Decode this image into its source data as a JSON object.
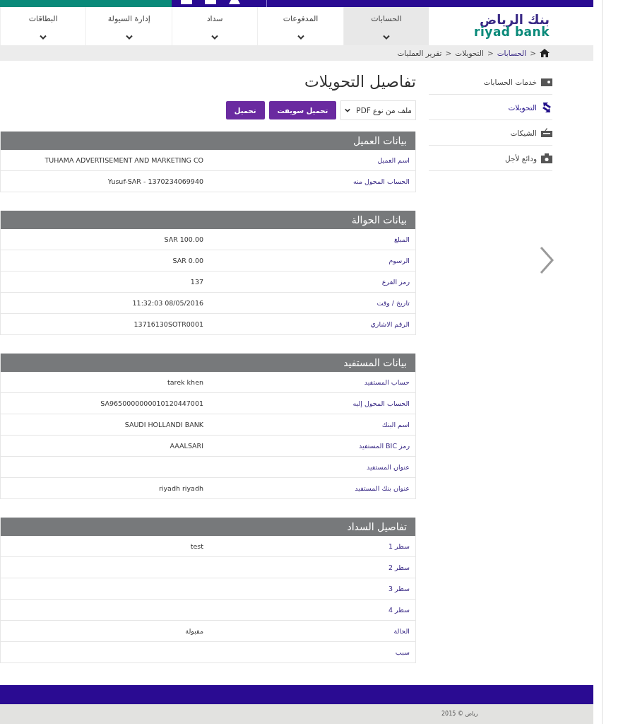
{
  "logo": {
    "arabic": "بنك الرياض",
    "latin": "riyad bank"
  },
  "nav": [
    {
      "label": "الحسابات",
      "selected": true
    },
    {
      "label": "المدفوعات",
      "selected": false
    },
    {
      "label": "سداد",
      "selected": false
    },
    {
      "label": "إدارة السيولة",
      "selected": false
    },
    {
      "label": "البطاقات",
      "selected": false
    }
  ],
  "breadcrumb": [
    {
      "separator": ">",
      "label": "الحسابات",
      "link": true
    },
    {
      "separator": ">",
      "label": "التحويلات",
      "link": false
    },
    {
      "separator": ">",
      "label": "تقرير العمليات",
      "link": false
    }
  ],
  "sidebar": {
    "items": [
      {
        "label": "خدمات الحسابات",
        "selected": false
      },
      {
        "label": "التحويلات",
        "selected": true
      },
      {
        "label": "الشيكات",
        "selected": false
      },
      {
        "label": "ودائع لأجل",
        "selected": false
      }
    ]
  },
  "page_title": "تفاصيل التحويلات",
  "file_type": {
    "value": "ملف من نوع PDF"
  },
  "buttons": [
    "تحميل سويفت",
    "تحميل"
  ],
  "sections": [
    {
      "title": "بيانات العميل",
      "rows": [
        {
          "label": "اسم العميل",
          "value": "TUHAMA ADVERTISEMENT AND MARKETING CO"
        },
        {
          "label": "الحساب المحول منه",
          "value": "Yusuf-SAR - 1370234069940"
        }
      ]
    },
    {
      "title": "بيانات الحوالة",
      "rows": [
        {
          "label": "المبلغ",
          "value": "SAR 100.00"
        },
        {
          "label": "الرسوم",
          "value": "SAR 0.00"
        },
        {
          "label": "رمز الفرع",
          "value": "137"
        },
        {
          "label": "تاريخ / وقت",
          "value": "11:32:03 08/05/2016"
        },
        {
          "label": "الرقم الاشاري",
          "value": "13716130SOTR0001"
        }
      ]
    },
    {
      "title": "بيانات المستفيد",
      "rows": [
        {
          "label": "حساب المستفيد",
          "value": "tarek khen"
        },
        {
          "label": "الحساب المحول إليه",
          "value": "SA9650000000010120447001"
        },
        {
          "label": "اسم البنك",
          "value": "SAUDI HOLLANDI BANK"
        },
        {
          "label": "رمز BIC المستفيد",
          "value": "AAALSARI"
        },
        {
          "label": "عنوان المستفيد"
        },
        {
          "label": "عنوان بنك المستفيد",
          "value": "riyadh riyadh"
        }
      ]
    },
    {
      "title": "تفاصيل السداد",
      "rows": [
        {
          "label": "سطر 1",
          "value": "test"
        },
        {
          "label": "سطر 2"
        },
        {
          "label": "سطر 3"
        },
        {
          "label": "سطر 4"
        },
        {
          "label": "الحالة",
          "value": "مقبولة"
        },
        {
          "label": "سبب"
        }
      ]
    }
  ],
  "footer": {
    "copyright": "رياض © 2015"
  }
}
